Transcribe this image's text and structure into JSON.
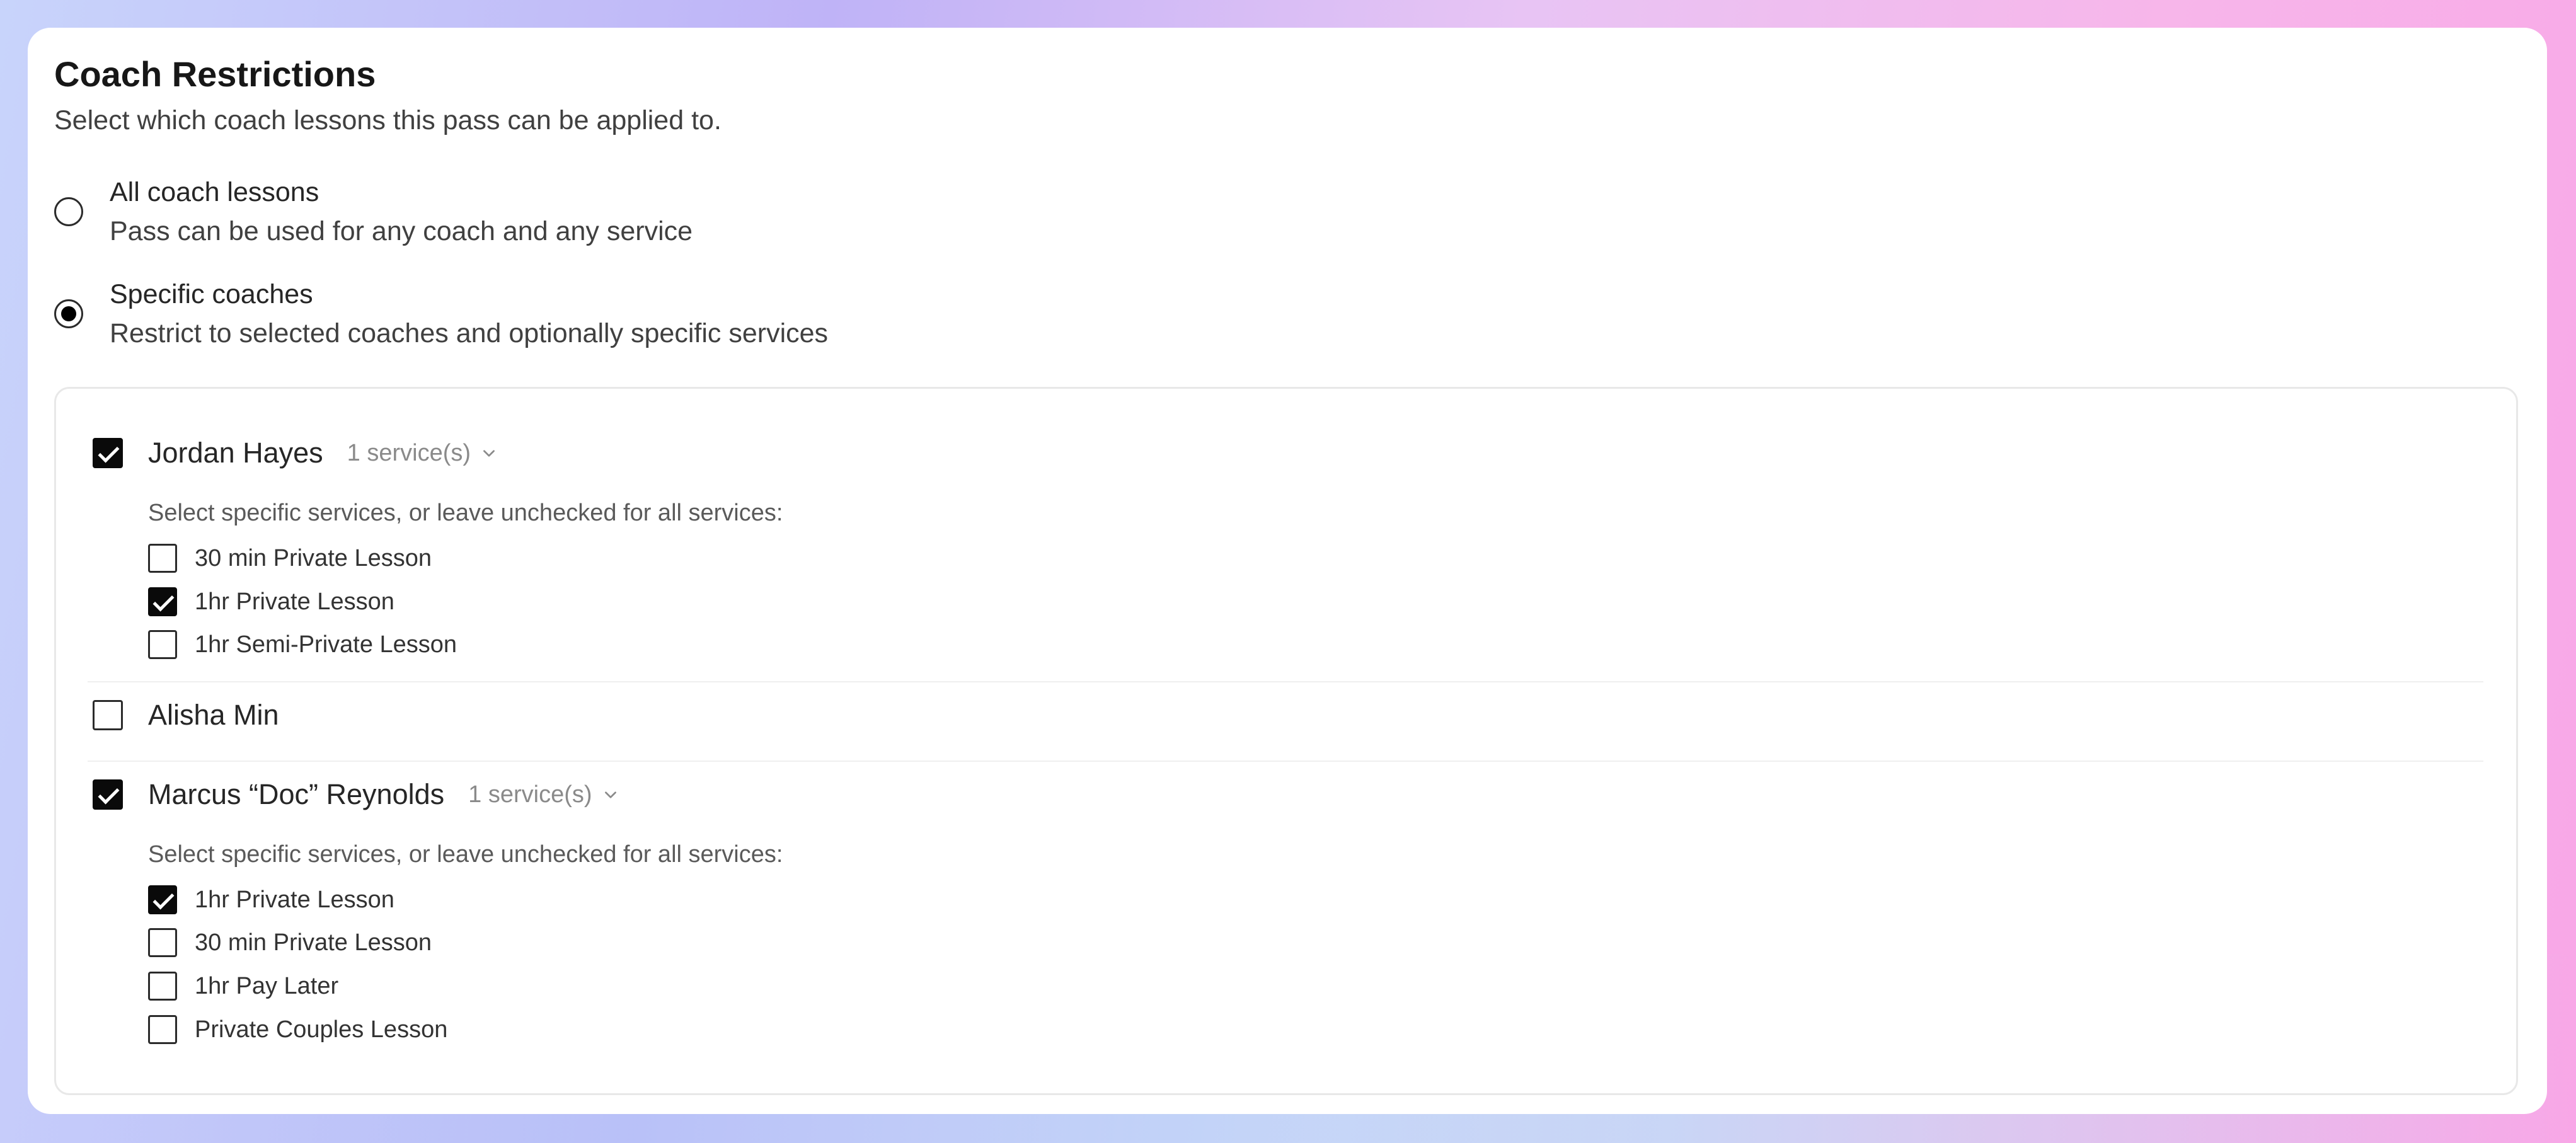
{
  "header": {
    "title": "Coach Restrictions",
    "subtitle": "Select which coach lessons this pass can be applied to."
  },
  "options": [
    {
      "label": "All coach lessons",
      "description": "Pass can be used for any coach and any service",
      "selected": false
    },
    {
      "label": "Specific coaches",
      "description": "Restrict to selected coaches and optionally specific services",
      "selected": true
    }
  ],
  "coaches": [
    {
      "name": "Jordan Hayes",
      "checked": true,
      "service_count": "1 service(s)",
      "hint": "Select specific services, or leave unchecked for all services:",
      "services": [
        {
          "label": "30 min Private Lesson",
          "checked": false
        },
        {
          "label": "1hr Private Lesson",
          "checked": true
        },
        {
          "label": "1hr Semi-Private Lesson",
          "checked": false
        }
      ]
    },
    {
      "name": "Alisha Min",
      "checked": false
    },
    {
      "name": "Marcus “Doc” Reynolds",
      "checked": true,
      "service_count": "1 service(s)",
      "hint": "Select specific services, or leave unchecked for all services:",
      "services": [
        {
          "label": "1hr Private Lesson",
          "checked": true
        },
        {
          "label": "30 min Private Lesson",
          "checked": false
        },
        {
          "label": "1hr Pay Later",
          "checked": false
        },
        {
          "label": "Private Couples Lesson",
          "checked": false
        }
      ]
    }
  ],
  "icons": {
    "expand": "chevron-down-icon",
    "check": "checkmark-icon"
  }
}
